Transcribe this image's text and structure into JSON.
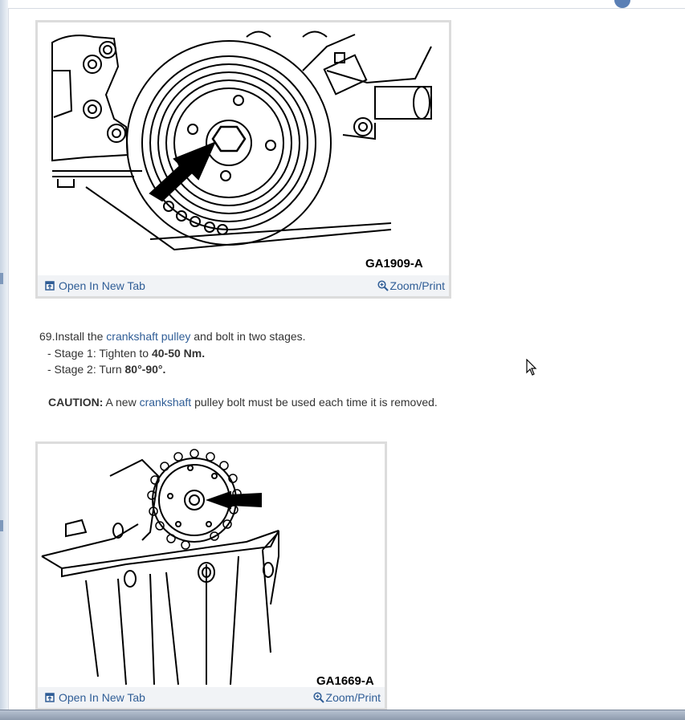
{
  "figures": [
    {
      "label": "GA1909-A",
      "open_tab": "Open In New Tab",
      "zoom_print": "Zoom/Print",
      "alt": "Crankshaft pulley bolt"
    },
    {
      "label": "GA1669-A",
      "open_tab": "Open In New Tab",
      "zoom_print": "Zoom/Print",
      "alt": "Crankshaft sprocket bolt"
    }
  ],
  "step": {
    "number": "69.",
    "text_before": "Install the ",
    "link": "crankshaft pulley",
    "text_after": " and bolt in two stages.",
    "stages": [
      {
        "prefix": "-  Stage 1: Tighten to ",
        "value": "40-50 Nm."
      },
      {
        "prefix": "-  Stage 2: Turn ",
        "value": "80°-90°."
      }
    ]
  },
  "caution": {
    "label": "CAUTION:",
    "text_before": " A new ",
    "link": "crankshaft",
    "text_after": " pulley bolt must be used each time it is removed."
  },
  "colors": {
    "link": "#2f5d96",
    "figure_border": "#dcdcdc",
    "figure_bar": "#f1f3f6"
  },
  "icons": [
    "open-tab-icon",
    "zoom-icon",
    "mouse-cursor-icon"
  ]
}
